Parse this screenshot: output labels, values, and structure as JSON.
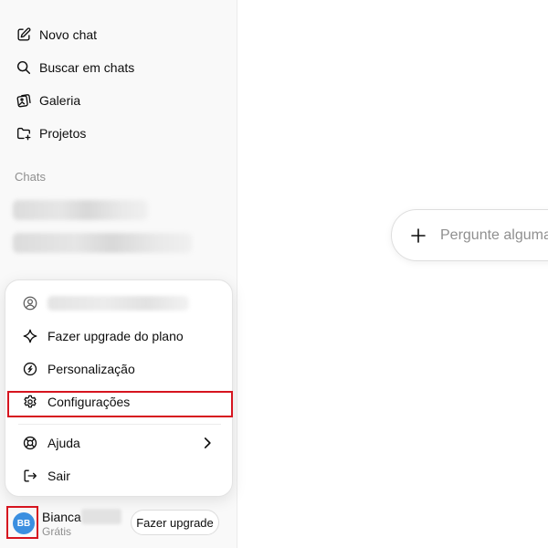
{
  "sidebar": {
    "nav": [
      {
        "label": "Novo chat",
        "icon": "new-chat-icon"
      },
      {
        "label": "Buscar em chats",
        "icon": "search-icon"
      },
      {
        "label": "Galeria",
        "icon": "gallery-icon"
      },
      {
        "label": "Projetos",
        "icon": "folder-plus-icon"
      }
    ],
    "chats_label": "Chats"
  },
  "menu": {
    "items": [
      {
        "label": "Fazer upgrade do plano",
        "icon": "sparkle-icon"
      },
      {
        "label": "Personalização",
        "icon": "personalization-icon"
      },
      {
        "label": "Configurações",
        "icon": "gear-icon"
      },
      {
        "label": "Ajuda",
        "icon": "lifebuoy-icon"
      },
      {
        "label": "Sair",
        "icon": "logout-icon"
      }
    ],
    "highlight_color": "#d6141f"
  },
  "user": {
    "initials": "BB",
    "name": "Bianca",
    "plan": "Grátis",
    "upgrade_label": "Fazer upgrade",
    "avatar_color": "#3b8fe0"
  },
  "composer": {
    "placeholder": "Pergunte alguma coisa"
  }
}
